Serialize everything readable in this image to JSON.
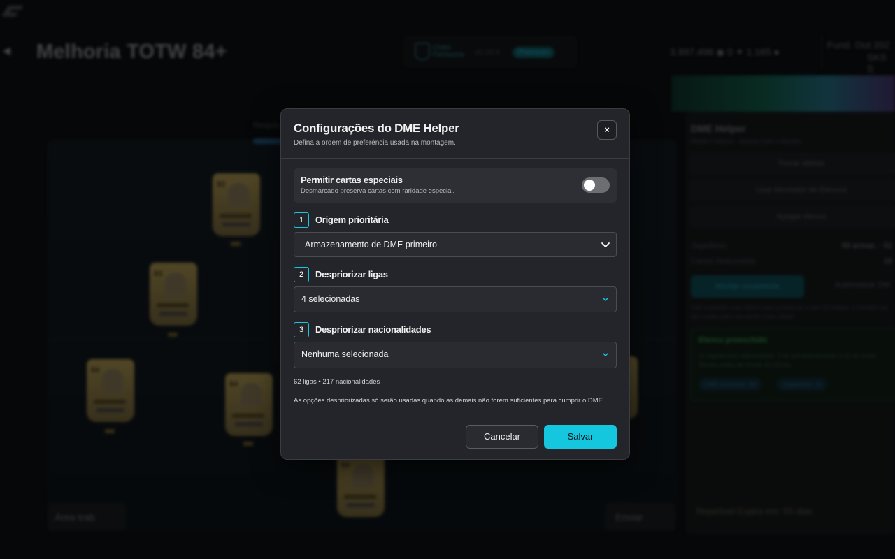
{
  "background": {
    "page_title": "Melhoria TOTW 84+",
    "club": {
      "name": "Clube Fantasma",
      "version": "v0.18.6",
      "badge": "Premium"
    },
    "currency": "3.997.498 ◉  0 ✦  1.165 ●",
    "fund_line1": "Fund. Out 202",
    "fund_line2": "SKS S",
    "requirements_label": "Requis",
    "side_panel": {
      "title": "DME Helper",
      "subtitle": "Monte o elenco · acesse tudo o desafio",
      "buttons": [
        "Trocar atletas",
        "Usar Montador de Elencos",
        "Apagar elenco"
      ],
      "rows": [
        {
          "label": "Jogadores",
          "value": "99 armaz. · 51"
        },
        {
          "label": "Cartas bloqueadas",
          "value": "10"
        }
      ],
      "primary_button": "Montar novamente",
      "auto_button": "Automatizar DM",
      "note": "Use o padrão mas vários para preservar o seu 91 helper, o cenário vai ser usado para ver se for mais viável.",
      "green_box": {
        "title": "Elenco preenchido",
        "text": "11 jogador(es) adicionados. 0 do armazenamento e 11 do clube. Revise antes de enviar em Envio.",
        "chips": [
          "DME estimado: 84",
          "Jogadores: 11"
        ]
      },
      "footer": "Repetível  Expira em: 55 dias"
    },
    "workspace_button": "Área trab.",
    "submit_button": "Enviar"
  },
  "modal": {
    "title": "Configurações do DME Helper",
    "subtitle": "Defina a ordem de preferência usada na montagem.",
    "close_label": "×",
    "toggle": {
      "label": "Permitir cartas especiais",
      "description": "Desmarcado preserva cartas com raridade especial.",
      "enabled": false
    },
    "steps": [
      {
        "number": "1",
        "label": "Origem prioritária",
        "value": "Armazenamento de DME primeiro"
      },
      {
        "number": "2",
        "label": "Despriorizar ligas",
        "value": "4 selecionadas"
      },
      {
        "number": "3",
        "label": "Despriorizar nacionalidades",
        "value": "Nenhuma selecionada"
      }
    ],
    "counts": "62 ligas • 217 nacionalidades",
    "note": "As opções despriorizadas só serão usadas quando as demais não forem suficientes para cumprir o DME.",
    "cancel_label": "Cancelar",
    "save_label": "Salvar"
  },
  "colors": {
    "accent": "#14c6de",
    "modal_bg": "#24252a",
    "toggle_off": "#6c6e72"
  },
  "icons": {
    "close": "close-icon",
    "dropdown": "chevron-down-icon",
    "back": "back-arrow-icon"
  }
}
